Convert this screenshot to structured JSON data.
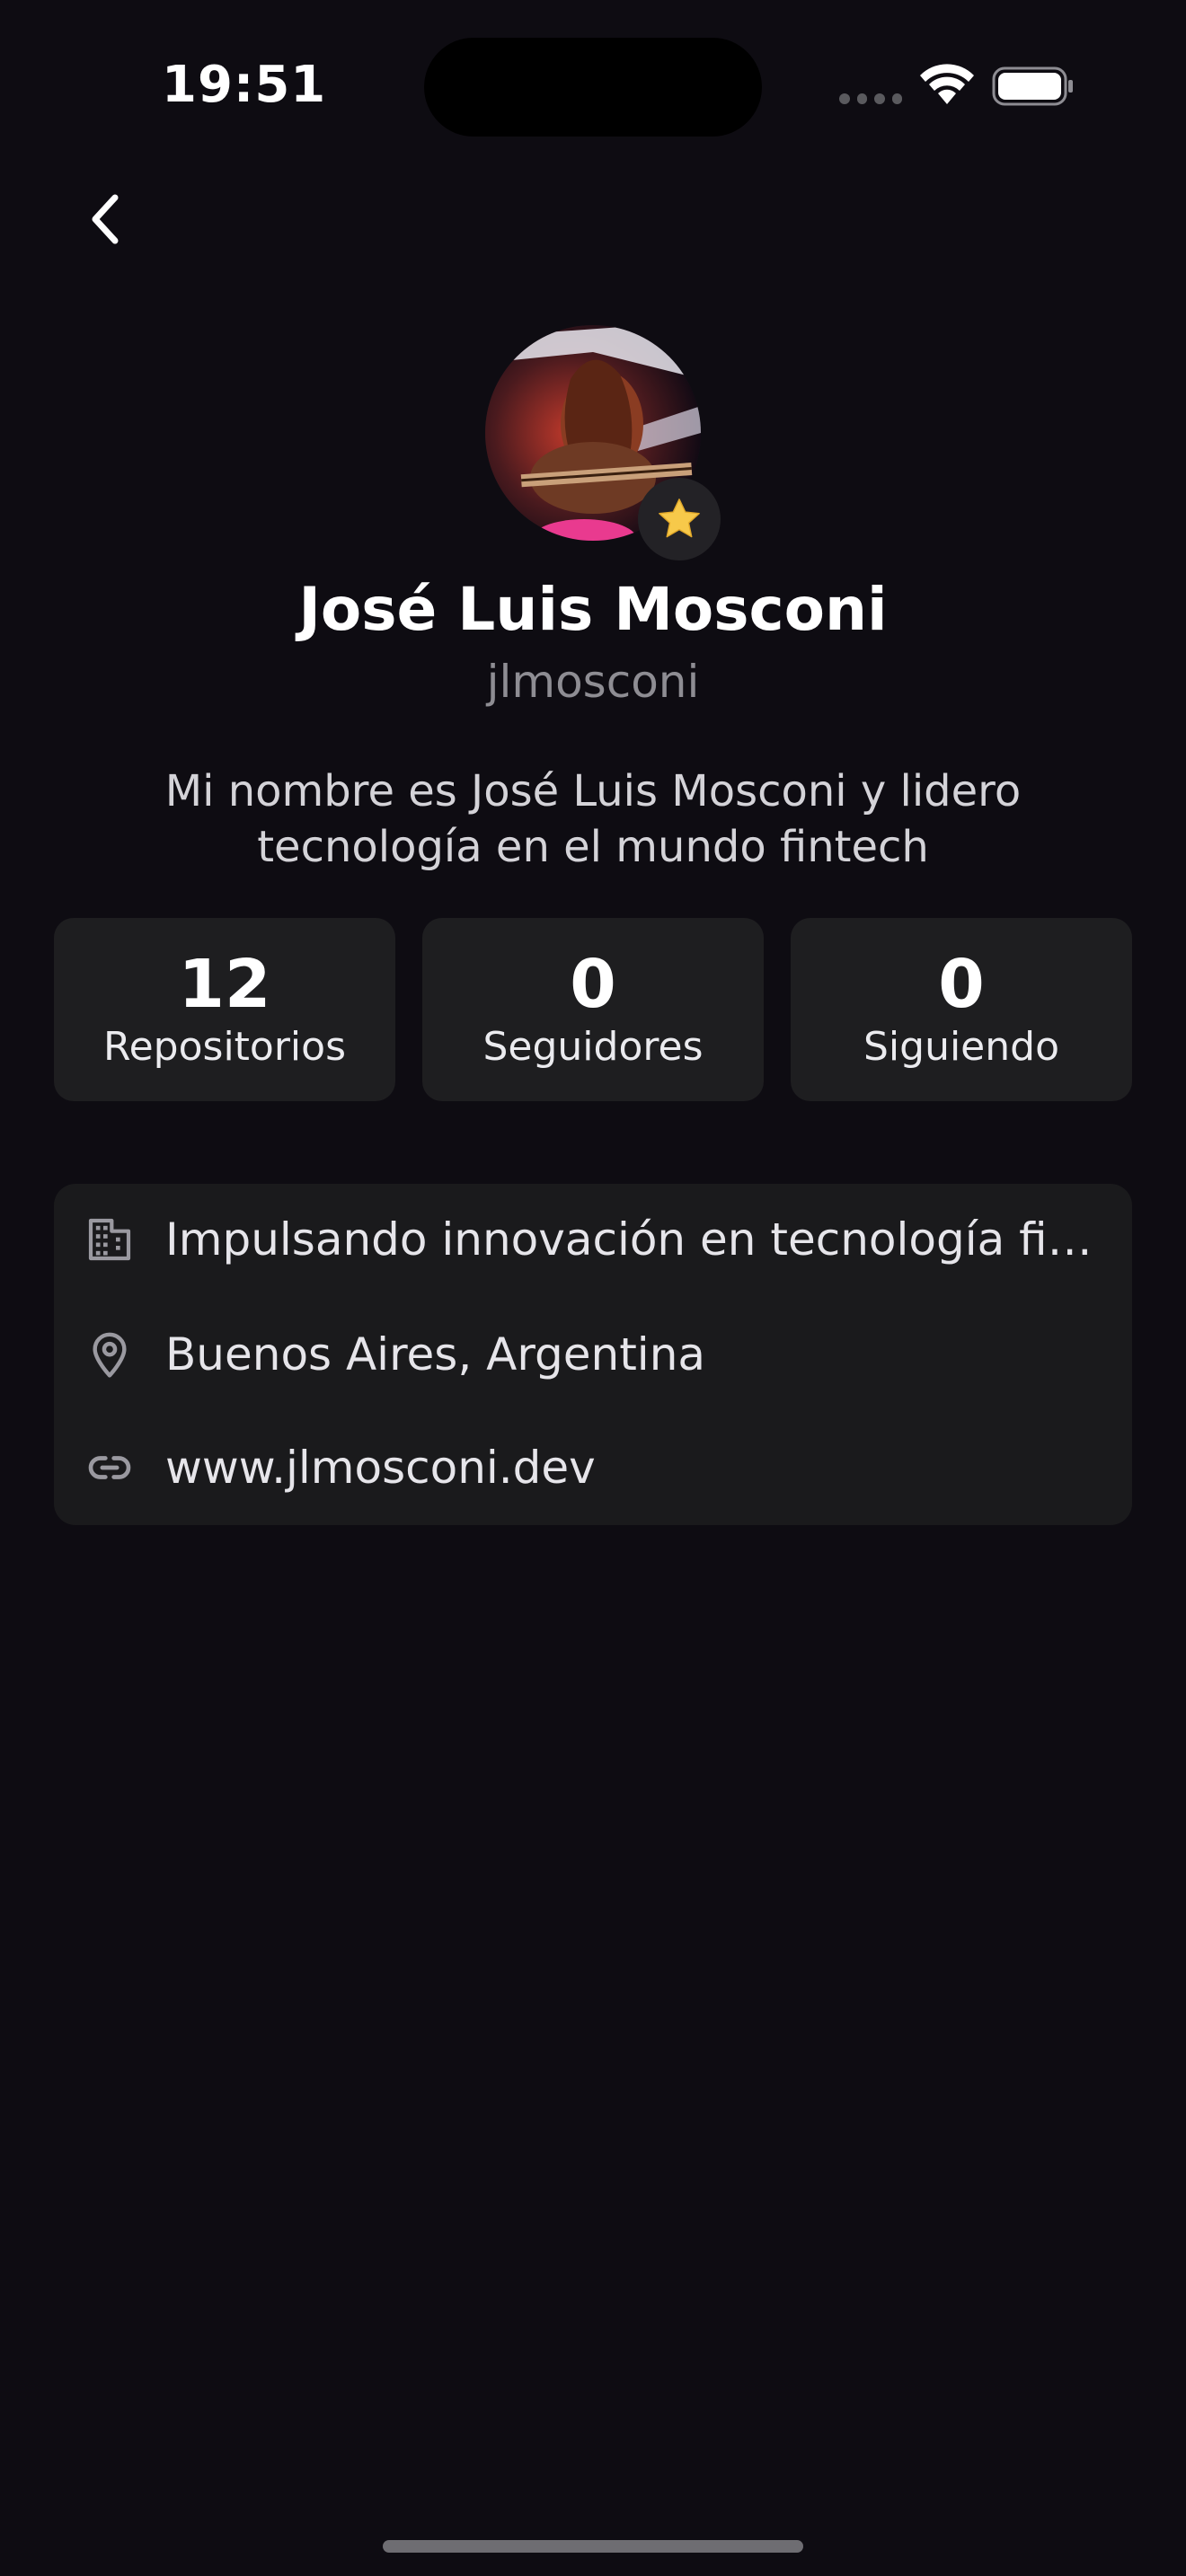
{
  "status_bar": {
    "time": "19:51"
  },
  "profile": {
    "name": "José Luis Mosconi",
    "username": "jlmosconi",
    "bio": "Mi nombre es José Luis Mosconi y lidero tecnología en el mundo fintech"
  },
  "stats": [
    {
      "value": "12",
      "label": "Repositorios"
    },
    {
      "value": "0",
      "label": "Seguidores"
    },
    {
      "value": "0",
      "label": "Siguiendo"
    }
  ],
  "info": {
    "company": "Impulsando innovación en tecnología fin...",
    "location": "Buenos Aires, Argentina",
    "website": "www.jlmosconi.dev"
  },
  "icons": {
    "back": "chevron-left-icon",
    "badge": "star-icon",
    "company": "building-icon",
    "location": "location-pin-icon",
    "website": "link-icon"
  },
  "colors": {
    "background": "#0e0c12",
    "card": "#1e1e20",
    "star": "#f7c94a",
    "muted_text": "#8e8d93"
  }
}
